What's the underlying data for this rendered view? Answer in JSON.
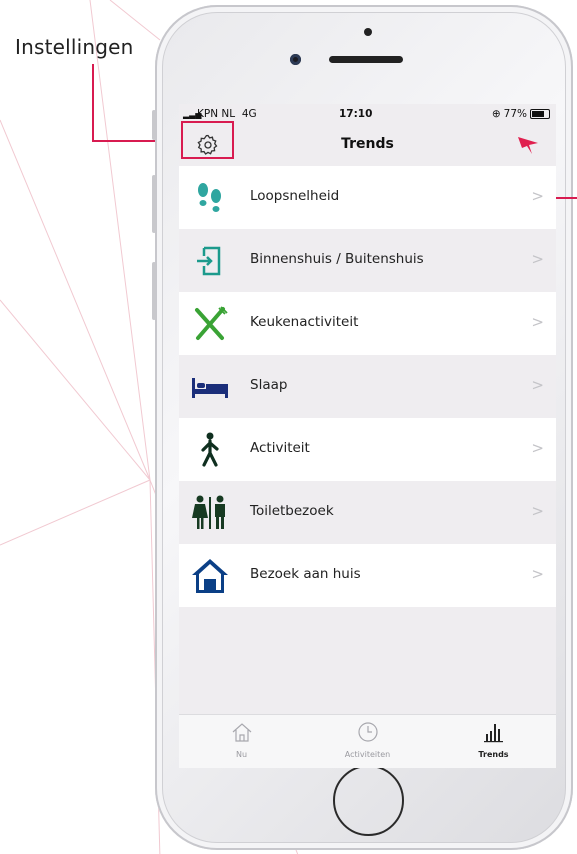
{
  "callout": {
    "label": "Instellingen"
  },
  "status_bar": {
    "carrier": "KPN NL",
    "network": "4G",
    "time": "17:10",
    "battery": "77%"
  },
  "nav": {
    "title": "Trends",
    "settings_icon": "gear-icon",
    "logo_icon": "bird-logo-icon"
  },
  "list_items": [
    {
      "label": "Loopsnelheid",
      "icon": "footsteps-icon",
      "color": "#2fa6a0"
    },
    {
      "label": "Binnenshuis / Buitenshuis",
      "icon": "door-enter-icon",
      "color": "#1c9a8c"
    },
    {
      "label": "Keukenactiviteit",
      "icon": "fork-knife-icon",
      "color": "#3aa335"
    },
    {
      "label": "Slaap",
      "icon": "bed-icon",
      "color": "#1b2e7a"
    },
    {
      "label": "Activiteit",
      "icon": "walking-person-icon",
      "color": "#0f2f1f"
    },
    {
      "label": "Toiletbezoek",
      "icon": "restroom-icon",
      "color": "#173a22"
    },
    {
      "label": "Bezoek aan huis",
      "icon": "house-icon",
      "color": "#0b3f86"
    }
  ],
  "tabs": [
    {
      "label": "Nu",
      "icon": "home-icon",
      "active": false
    },
    {
      "label": "Activiteiten",
      "icon": "clock-icon",
      "active": false
    },
    {
      "label": "Trends",
      "icon": "bar-chart-icon",
      "active": true
    }
  ],
  "colors": {
    "accent": "#d81b50",
    "background": "#efedf0"
  }
}
